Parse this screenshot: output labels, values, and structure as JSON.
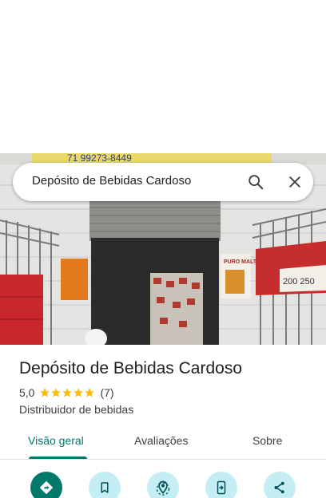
{
  "search": {
    "query": "Depósito de Bebidas Cardoso"
  },
  "photo": {
    "phone_sign": "71 99273-8449",
    "poster_right_top": "PURO MALTE",
    "banner_text": "200  250"
  },
  "place": {
    "name": "Depósito de Bebidas Cardoso",
    "rating": "5,0",
    "stars": 5,
    "review_count": "(7)",
    "category": "Distribuidor de bebidas"
  },
  "tabs": [
    {
      "label": "Visão geral",
      "active": true
    },
    {
      "label": "Avaliações",
      "active": false
    },
    {
      "label": "Sobre",
      "active": false
    }
  ],
  "actions": [
    {
      "icon": "directions-icon"
    },
    {
      "icon": "bookmark-icon"
    },
    {
      "icon": "nearby-icon"
    },
    {
      "icon": "send-to-phone-icon"
    },
    {
      "icon": "share-icon"
    }
  ],
  "colors": {
    "accent": "#00796b",
    "action_bg": "#c4eef3",
    "star": "#fbbc04"
  }
}
